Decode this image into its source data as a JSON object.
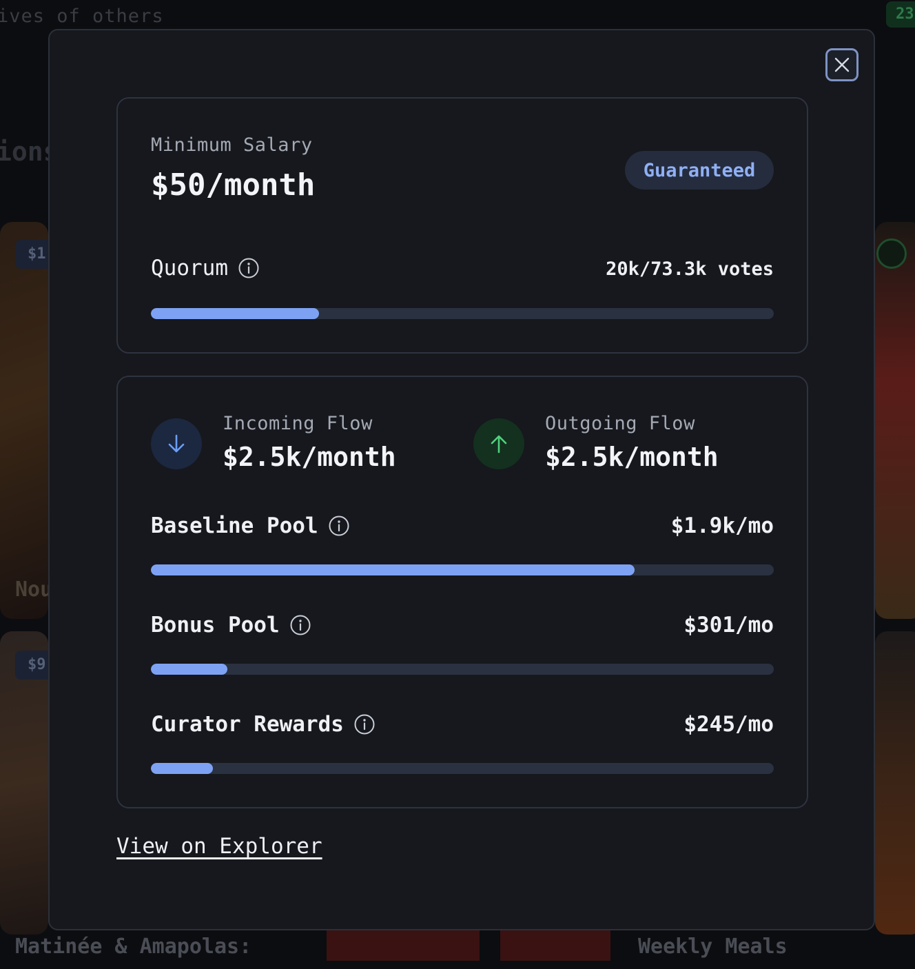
{
  "background": {
    "top_text": "ives of others",
    "heading_fragment": "ions",
    "count_badge": "23",
    "price_tag_1": "$1",
    "price_tag_2": "$9",
    "card_title_fragment": "Nou",
    "bottom_left_title": "Matinée & Amapolas:",
    "bottom_right_title": "Weekly Meals"
  },
  "modal": {
    "close_icon": "close-icon",
    "salary_card": {
      "label": "Minimum Salary",
      "value": "$50/month",
      "badge": "Guaranteed",
      "quorum": {
        "label": "Quorum",
        "value": "20k/73.3k votes",
        "progress": 0.27
      }
    },
    "flows_card": {
      "incoming": {
        "label": "Incoming Flow",
        "value": "$2.5k/month",
        "icon": "arrow-down-icon"
      },
      "outgoing": {
        "label": "Outgoing Flow",
        "value": "$2.5k/month",
        "icon": "arrow-up-icon"
      },
      "pools": [
        {
          "label": "Baseline Pool",
          "value": "$1.9k/mo",
          "progress": 0.777
        },
        {
          "label": "Bonus Pool",
          "value": "$301/mo",
          "progress": 0.123
        },
        {
          "label": "Curator Rewards",
          "value": "$245/mo",
          "progress": 0.1
        }
      ]
    },
    "explorer_link": "View on Explorer"
  },
  "colors": {
    "accent": "#7ea2f3",
    "badge_text": "#8fb0f5",
    "incoming_icon": "#6b9ef5",
    "outgoing_icon": "#4fd17c"
  }
}
